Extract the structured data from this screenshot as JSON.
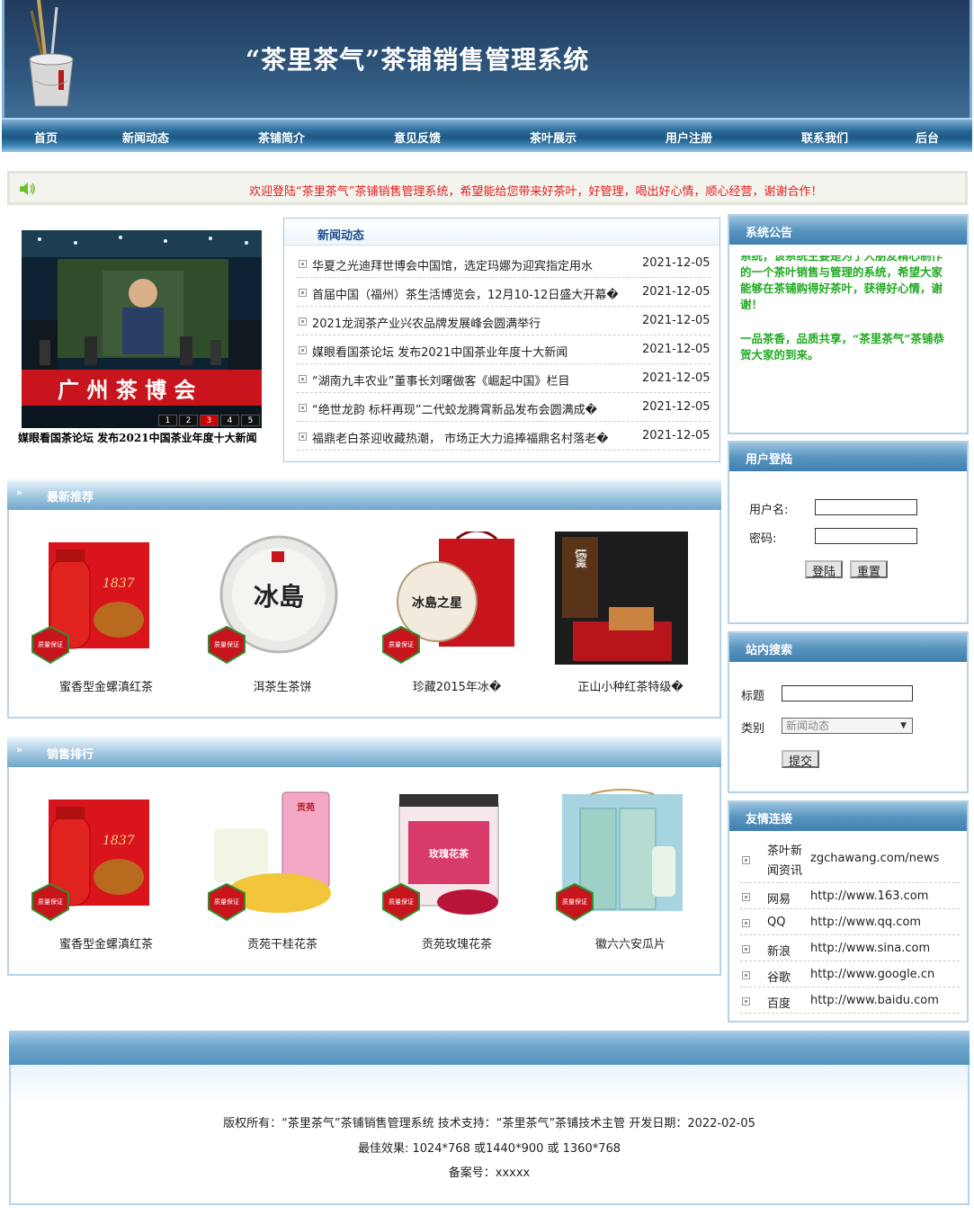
{
  "header": {
    "title": "“茶里茶气”茶铺销售管理系统"
  },
  "nav": [
    "首页",
    "新闻动态",
    "茶铺简介",
    "意见反馈",
    "茶叶展示",
    "用户注册",
    "联系我们",
    "后台"
  ],
  "notice": "欢迎登陆“茶里茶气”茶铺销售管理系统，希望能给您带来好茶叶，好管理，喝出好心情，顺心经营，谢谢合作！",
  "slideshow": {
    "image_text": "广 州 茶 博 会",
    "caption": "媒眼看国茶论坛 发布2021中国茶业年度十大新闻",
    "pager": [
      "1",
      "2",
      "3",
      "4",
      "5"
    ],
    "active_page": 3
  },
  "news": {
    "heading": "新闻动态",
    "items": [
      {
        "title": "华夏之光迪拜世博会中国馆，选定玛娜为迎宾指定用水",
        "date": "2021-12-05"
      },
      {
        "title": "首届中国（福州）茶生活博览会，12月10-12日盛大开幕�",
        "date": "2021-12-05"
      },
      {
        "title": "2021龙润茶产业兴农品牌发展峰会圆满举行",
        "date": "2021-12-05"
      },
      {
        "title": "媒眼看国茶论坛 发布2021中国茶业年度十大新闻",
        "date": "2021-12-05"
      },
      {
        "title": "“湖南九丰农业”董事长刘曙做客《崛起中国》栏目",
        "date": "2021-12-05"
      },
      {
        "title": "“绝世龙韵 标杆再现”二代蛟龙腾霄新品发布会圆满成�",
        "date": "2021-12-05"
      },
      {
        "title": "福鼎老白茶迎收藏热潮， 市场正大力追捧福鼎名村落老�",
        "date": "2021-12-05"
      }
    ]
  },
  "recommend": {
    "heading": "最新推荐",
    "arrow": "»",
    "products": [
      {
        "name": "蜜香型金螺滇红茶",
        "image_text": "1837",
        "badge": "质量保证"
      },
      {
        "name": "洱茶生茶饼",
        "image_text": "冰島",
        "badge": "质量保证"
      },
      {
        "name": "珍藏2015年冰�",
        "image_text": "冰島之星",
        "badge": "质量保证"
      },
      {
        "name": "正山小种红茶特级�",
        "image_text": "严选500克",
        "badge": ""
      }
    ]
  },
  "ranking": {
    "heading": "销售排行",
    "arrow": "»",
    "products": [
      {
        "name": "蜜香型金螺滇红茶",
        "image_text": "1837",
        "badge": "质量保证"
      },
      {
        "name": "贡苑干桂花茶",
        "image_text": "贡苑",
        "badge": "质量保证"
      },
      {
        "name": "贡苑玫瑰花茶",
        "image_text": "玫瑰花茶",
        "badge": "质量保证"
      },
      {
        "name": "徽六六安瓜片",
        "image_text": "",
        "badge": "质量保证"
      }
    ]
  },
  "announcement": {
    "heading": "系统公告",
    "text_1": "系统，该系统主要是为了人朋友精心制作的一个茶叶销售与管理的系统，希望大家能够在茶铺购得好茶叶，获得好心情，谢谢！",
    "text_2": "一品茶香，品质共享，“茶里茶气”茶铺恭贺大家的到来。"
  },
  "login": {
    "heading": "用户登陆",
    "username_label": "用户名:",
    "password_label": "密码:",
    "login_button": "登陆",
    "reset_button": "重置"
  },
  "search": {
    "heading": "站内搜索",
    "title_label": "标题",
    "category_label": "类别",
    "category_value": "新闻动态",
    "submit_button": "提交"
  },
  "links": {
    "heading": "友情连接",
    "items": [
      {
        "name": "茶叶新闻资讯",
        "url": "zgchawang.com/news"
      },
      {
        "name": "网易",
        "url": "http://www.163.com"
      },
      {
        "name": "QQ",
        "url": "http://www.qq.com"
      },
      {
        "name": "新浪",
        "url": "http://www.sina.com"
      },
      {
        "name": "谷歌",
        "url": "http://www.google.cn"
      },
      {
        "name": "百度",
        "url": "http://www.baidu.com"
      }
    ]
  },
  "footer": {
    "line1": "版权所有：“茶里茶气”茶铺销售管理系统   技术支持：“茶里茶气”茶铺技术主管   开发日期：2022-02-05",
    "line2": "最佳效果: 1024*768 或1440*900 或 1360*768",
    "line3": "备案号：xxxxx"
  },
  "colors": {
    "header_bg": "#2d5379",
    "notice_red": "#e02020",
    "announce_green": "#22aa22",
    "news_heading": "#1b4f8a"
  }
}
